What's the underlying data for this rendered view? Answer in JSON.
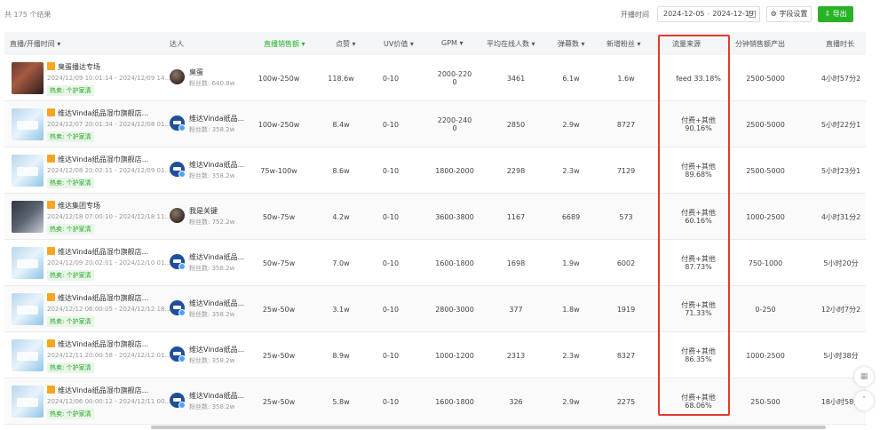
{
  "toolbar": {
    "result_count": "共 175 个结果",
    "date_label": "开播时间",
    "date_start": "2024-12-05",
    "date_sep": "-",
    "date_end": "2024-12-19",
    "field_settings": "⚙ 字段设置",
    "export": "⇩ 导出"
  },
  "columns": {
    "live": "直播/开播时间 ▾",
    "kol": "达人",
    "sales": "直播销售额 ▾",
    "likes": "点赞 ▾",
    "uv": "UV价值 ▾",
    "gpm": "GPM ▾",
    "online": "平均在线人数 ▾",
    "danmu": "弹幕数 ▾",
    "newfans": "新增粉丝 ▾",
    "traffic": "流量来源",
    "permin": "分钟销售额产出",
    "duration": "直播时长"
  },
  "rows": [
    {
      "thumb": "person",
      "title": "臭蛋播达专场",
      "time": "2024/12/09 10:01:14 - 2024/12/09 14...",
      "badge": "热卖: 个护家清",
      "avatar": "dark",
      "kol": "臭蛋",
      "fans": "粉丝数: 640.8w",
      "sales": "100w-250w",
      "likes": "118.6w",
      "uv": "0-10",
      "gpm": "2000-220\n0",
      "online": "3461",
      "danmu": "6.1w",
      "newfans": "1.6w",
      "traffic": "feed  33.18%",
      "permin": "2500-5000",
      "duration": "4小时57分2"
    },
    {
      "thumb": "promo",
      "title": "维达Vinda纸品湿巾旗舰店...",
      "time": "2024/12/07 20:01:34 - 2024/12/08 01...",
      "badge": "热卖: 个护家清",
      "avatar": "vinda",
      "kol": "维达Vinda纸品...",
      "fans": "粉丝数: 358.2w",
      "sales": "100w-250w",
      "likes": "8.4w",
      "uv": "0-10",
      "gpm": "2200-240\n0",
      "online": "2850",
      "danmu": "2.9w",
      "newfans": "8727",
      "traffic": "付费+其他\n90.16%",
      "permin": "2500-5000",
      "duration": "5小时22分1"
    },
    {
      "thumb": "promo",
      "title": "维达Vinda纸品湿巾旗舰店...",
      "time": "2024/12/08 20:02:11 - 2024/12/09 01...",
      "badge": "热卖: 个护家清",
      "avatar": "vinda",
      "kol": "维达Vinda纸品...",
      "fans": "粉丝数: 358.2w",
      "sales": "75w-100w",
      "likes": "8.6w",
      "uv": "0-10",
      "gpm": "1800-2000",
      "online": "2298",
      "danmu": "2.3w",
      "newfans": "7129",
      "traffic": "付费+其他\n89.68%",
      "permin": "2500-5000",
      "duration": "5小时23分1"
    },
    {
      "thumb": "suit",
      "title": "维达集团专场",
      "time": "2024/12/18 07:00:10 - 2024/12/18 11:...",
      "badge": "热卖: 个护家清",
      "avatar": "dark",
      "kol": "我是关键",
      "fans": "粉丝数: 752.2w",
      "sales": "50w-75w",
      "likes": "4.2w",
      "uv": "0-10",
      "gpm": "3600-3800",
      "online": "1167",
      "danmu": "6689",
      "newfans": "573",
      "traffic": "付费+其他\n60.16%",
      "permin": "1000-2500",
      "duration": "4小时31分2"
    },
    {
      "thumb": "promo",
      "title": "维达Vinda纸品湿巾旗舰店...",
      "time": "2024/12/09 20:02:01 - 2024/12/10 01...",
      "badge": "热卖: 个护家清",
      "avatar": "vinda",
      "kol": "维达Vinda纸品...",
      "fans": "粉丝数: 358.2w",
      "sales": "50w-75w",
      "likes": "7.0w",
      "uv": "0-10",
      "gpm": "1600-1800",
      "online": "1698",
      "danmu": "1.9w",
      "newfans": "6002",
      "traffic": "付费+其他\n87.73%",
      "permin": "750-1000",
      "duration": "5小时20分"
    },
    {
      "thumb": "promo",
      "title": "维达Vinda纸品湿巾旗舰店...",
      "time": "2024/12/12 06:00:05 - 2024/12/12 18...",
      "badge": "热卖: 个护家清",
      "avatar": "vinda",
      "kol": "维达Vinda纸品...",
      "fans": "粉丝数: 358.2w",
      "sales": "25w-50w",
      "likes": "3.1w",
      "uv": "0-10",
      "gpm": "2800-3000",
      "online": "377",
      "danmu": "1.8w",
      "newfans": "1919",
      "traffic": "付费+其他\n71.33%",
      "permin": "0-250",
      "duration": "12小时7分2"
    },
    {
      "thumb": "promo",
      "title": "维达Vinda纸品湿巾旗舰店...",
      "time": "2024/12/11 20:00:58 - 2024/12/12 01...",
      "badge": "热卖: 个护家清",
      "avatar": "vinda",
      "kol": "维达Vinda纸品...",
      "fans": "粉丝数: 358.2w",
      "sales": "25w-50w",
      "likes": "8.9w",
      "uv": "0-10",
      "gpm": "1000-1200",
      "online": "2313",
      "danmu": "2.3w",
      "newfans": "8327",
      "traffic": "付费+其他\n86.35%",
      "permin": "1000-2500",
      "duration": "5小时38分"
    },
    {
      "thumb": "promo",
      "title": "维达Vinda纸品湿巾旗舰店...",
      "time": "2024/12/06 00:00:12 - 2024/12/11 00...",
      "badge": "热卖: 个护家清",
      "avatar": "vinda",
      "kol": "维达Vinda纸品...",
      "fans": "粉丝数: 358.2w",
      "sales": "25w-50w",
      "likes": "5.8w",
      "uv": "0-10",
      "gpm": "1600-1800",
      "online": "326",
      "danmu": "2.9w",
      "newfans": "2275",
      "traffic": "付费+其他\n68.06%",
      "permin": "250-500",
      "duration": "18小时58分"
    }
  ]
}
